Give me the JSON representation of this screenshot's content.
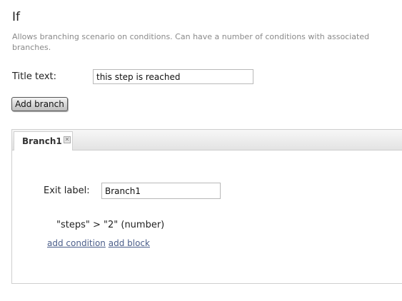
{
  "header": {
    "title": "If",
    "description": "Allows branching scenario on conditions. Can have a number of conditions with associated branches."
  },
  "form": {
    "title_label": "Title text:",
    "title_value": "this step is reached",
    "add_branch_label": "Add branch"
  },
  "tabs": [
    {
      "label": "Branch1",
      "active": true
    }
  ],
  "branch": {
    "exit_label": "Exit label:",
    "exit_value": "Branch1",
    "condition": "\"steps\" > \"2\" (number)",
    "add_condition_label": "add condition",
    "add_block_label": "add block"
  },
  "icons": {
    "tab_close": "close-icon"
  }
}
